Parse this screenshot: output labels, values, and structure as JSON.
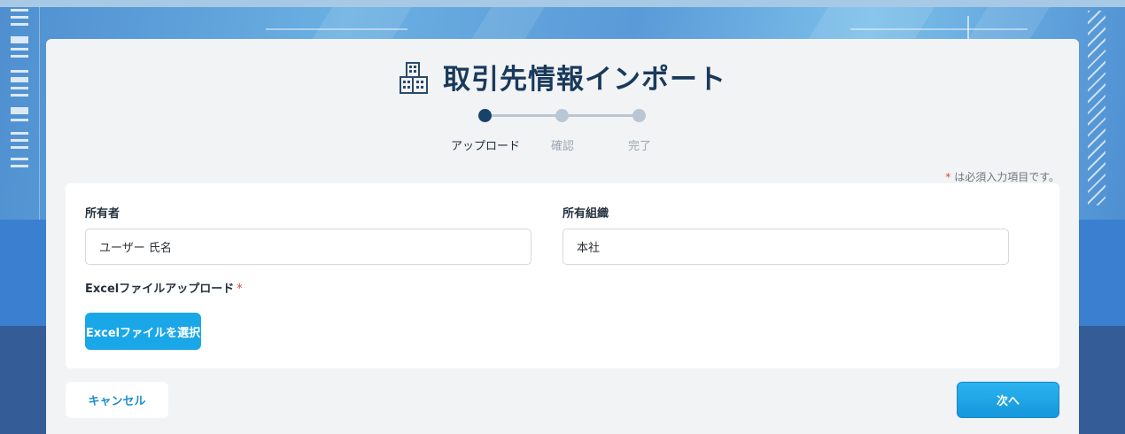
{
  "page": {
    "title": "取引先情報インポート",
    "title_icon": "building-icon"
  },
  "steps": [
    {
      "label": "アップロード",
      "status": "current"
    },
    {
      "label": "確認",
      "status": "pending"
    },
    {
      "label": "完了",
      "status": "pending"
    }
  ],
  "required_note": {
    "star": "*",
    "text": "は必須入力項目です。"
  },
  "form": {
    "owner": {
      "label": "所有者",
      "value": "ユーザー 氏名"
    },
    "organization": {
      "label": "所有組織",
      "value": "本社"
    },
    "excel_upload": {
      "label": "Excelファイルアップロード",
      "required_mark": "*",
      "button_label": "Excelファイルを選択"
    }
  },
  "footer": {
    "cancel_label": "キャンセル",
    "next_label": "次へ"
  },
  "colors": {
    "title": "#193a5b",
    "step_active": "#17426a",
    "step_inactive": "#b9c6d3",
    "primary_button": "#1aa7e8",
    "required_star": "#e0443a",
    "card": "#f2f3f5"
  }
}
